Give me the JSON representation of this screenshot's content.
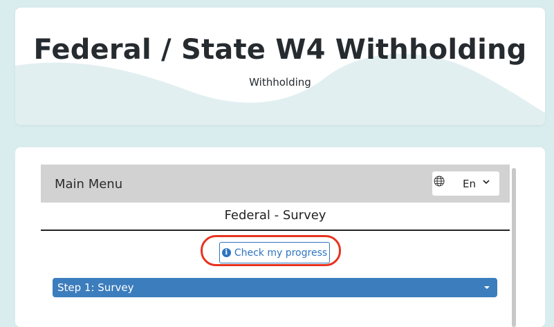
{
  "header": {
    "title": "Federal / State W4 Withholding",
    "subtitle": "Withholding"
  },
  "menu": {
    "title": "Main Menu",
    "language": {
      "value": "En",
      "icon": "globe-icon"
    }
  },
  "survey": {
    "title": "Federal - Survey",
    "progress_button": "Check my progress",
    "step": {
      "label": "Step 1: Survey"
    }
  },
  "colors": {
    "page_bg": "#d9ecee",
    "wave": "#e2eff1",
    "accent": "#2e74c0",
    "step_bar": "#3c7dbd",
    "highlight": "#e8321e",
    "menu_bar": "#d2d2d2"
  }
}
